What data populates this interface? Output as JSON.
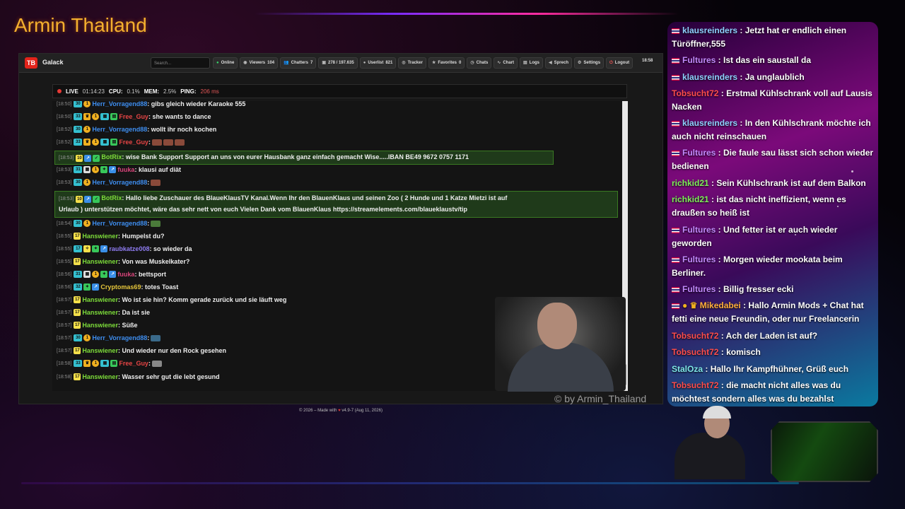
{
  "stream": {
    "title": "Armin Thailand",
    "watermark": "© by Armin_Thailand"
  },
  "app": {
    "name": "Galack",
    "search_placeholder": "Search...",
    "nav": [
      {
        "label": "Online",
        "icon": "online-dot-icon"
      },
      {
        "label": "Viewers",
        "value": "104",
        "icon": "eye-icon"
      },
      {
        "label": "Chatters",
        "value": "7",
        "icon": "users-icon"
      },
      {
        "label": "278 / 197.635",
        "icon": "chat-bubble-icon"
      },
      {
        "label": "Userlist",
        "value": "821",
        "icon": "user-icon"
      },
      {
        "label": "Tracker",
        "icon": "tracker-icon"
      },
      {
        "label": "Favorites",
        "value": "0",
        "icon": "star-icon"
      },
      {
        "label": "Chats",
        "icon": "clock-icon"
      },
      {
        "label": "Chart",
        "icon": "chart-icon"
      },
      {
        "label": "Logs",
        "icon": "log-icon"
      },
      {
        "label": "Sprech",
        "icon": "speaker-icon"
      },
      {
        "label": "Settings",
        "icon": "gear-icon"
      },
      {
        "label": "Logout",
        "icon": "logout-icon"
      }
    ],
    "clock": "18:58",
    "status": {
      "live_label": "LIVE",
      "uptime": "01:14:23",
      "cpu_label": "CPU:",
      "cpu": "0.1%",
      "mem_label": "MEM:",
      "mem": "2.5%",
      "ping_label": "PING:",
      "ping": "206 ms"
    },
    "footer": {
      "prefix": "© 2026 – Made with",
      "heart": "♥",
      "version": "v4.9-7 (Aug 11, 2026)"
    },
    "messages": [
      {
        "ts": "[18:50]",
        "user": "Herr_Vorragend88",
        "text": "gibs gleich wieder Karaoke 555"
      },
      {
        "ts": "[18:50]",
        "user": "Free_Guy",
        "text": "she wants to dance"
      },
      {
        "ts": "[18:52]",
        "user": "Herr_Vorragend88",
        "text": "wollt ihr noch kochen"
      },
      {
        "ts": "[18:52]",
        "user": "Free_Guy",
        "text": ""
      },
      {
        "ts": "[18:53]",
        "user": "BotRix",
        "text": "wise Bank Support Support an uns von eurer Hausbank ganz einfach gemacht Wise.....IBAN BE49 9672 0757 1171"
      },
      {
        "ts": "[18:53]",
        "user": "fuuka",
        "text": "klausi auf diät"
      },
      {
        "ts": "[18:53]",
        "user": "Herr_Vorragend88",
        "text": ""
      },
      {
        "ts": "[18:53]",
        "user": "BotRix",
        "text": "Hallo liebe Zuschauer des BlaueKlausTV Kanal.Wenn Ihr den BlauenKlaus und seinen Zoo ( 2 Hunde und 1 Katze Mietzi ist auf",
        "text2": "Urlaub ) unterstützen möchtet, wäre das sehr nett von euch Vielen Dank vom BlauenKlaus https://streamelements.com/blaueklaustv/tip"
      },
      {
        "ts": "[18:54]",
        "user": "Herr_Vorragend88",
        "text": ""
      },
      {
        "ts": "[18:55]",
        "user": "Hanswiener",
        "text": "Humpelst du?"
      },
      {
        "ts": "[18:55]",
        "user": "raubkatze008",
        "text": "so wieder da"
      },
      {
        "ts": "[18:55]",
        "user": "Hanswiener",
        "text": "Von was Muskelkater?"
      },
      {
        "ts": "[18:56]",
        "user": "fuuka",
        "text": "bettsport"
      },
      {
        "ts": "[18:56]",
        "user": "Cryptomas69",
        "text": "totes Toast"
      },
      {
        "ts": "[18:57]",
        "user": "Hanswiener",
        "text": "Wo ist sie hin? Komm gerade zurück und sie läuft weg"
      },
      {
        "ts": "[18:57]",
        "user": "Hanswiener",
        "text": "Da ist sie"
      },
      {
        "ts": "[18:57]",
        "user": "Hanswiener",
        "text": "Süße"
      },
      {
        "ts": "[18:57]",
        "user": "Herr_Vorragend88",
        "text": ""
      },
      {
        "ts": "[18:57]",
        "user": "Hanswiener",
        "text": "Und wieder nur den Rock gesehen"
      },
      {
        "ts": "[18:58]",
        "user": "Free_Guy",
        "text": ""
      },
      {
        "ts": "[18:58]",
        "user": "Hanswiener",
        "text": "Wasser sehr gut die lebt gesund"
      }
    ]
  },
  "side_chat": [
    {
      "user": "klausreinders",
      "text": "Jetzt hat er endlich einen Türöffner,555"
    },
    {
      "user": "Fultures",
      "text": "Ist das ein saustall da"
    },
    {
      "user": "klausreinders",
      "text": "Ja unglaublich"
    },
    {
      "user": "Tobsucht72",
      "text": "Erstmal Kühlschrank voll auf Lausis Nacken"
    },
    {
      "user": "klausreinders",
      "text": "In den Kühlschrank möchte ich auch nicht reinschauen"
    },
    {
      "user": "Fultures",
      "text": "Die faule sau lässt sich schon wieder bedienen"
    },
    {
      "user": "richkid21",
      "text": "Sein Kühlschrank ist auf dem Balkon"
    },
    {
      "user": "richkid21",
      "text": "ist das nicht ineffizient, wenn es draußen so heiß ist"
    },
    {
      "user": "Fultures",
      "text": "Und fetter ist er auch wieder geworden"
    },
    {
      "user": "Fultures",
      "text": "Morgen wieder mookata beim Berliner."
    },
    {
      "user": "Fultures",
      "text": "Billig fresser ecki"
    },
    {
      "user": "Mikedabei",
      "text": "Hallo Armin Mods + Chat hat fetti eine neue Freundin, oder nur Freelancerin"
    },
    {
      "user": "Tobsucht72",
      "text": "Ach der Laden ist auf?"
    },
    {
      "user": "Tobsucht72",
      "text": "komisch"
    },
    {
      "user": "StalOza",
      "text": "Hallo Ihr Kampfhühner, Grüß euch"
    },
    {
      "user": "Tobsucht72",
      "text": "die macht nicht alles was du möchtest sondern alles was du bezahlst"
    }
  ],
  "colors": {
    "title": "#f4b02e",
    "live": "#e53935",
    "botrix_bg": "#1f3a1a",
    "accent_green": "#7ddc3a"
  }
}
